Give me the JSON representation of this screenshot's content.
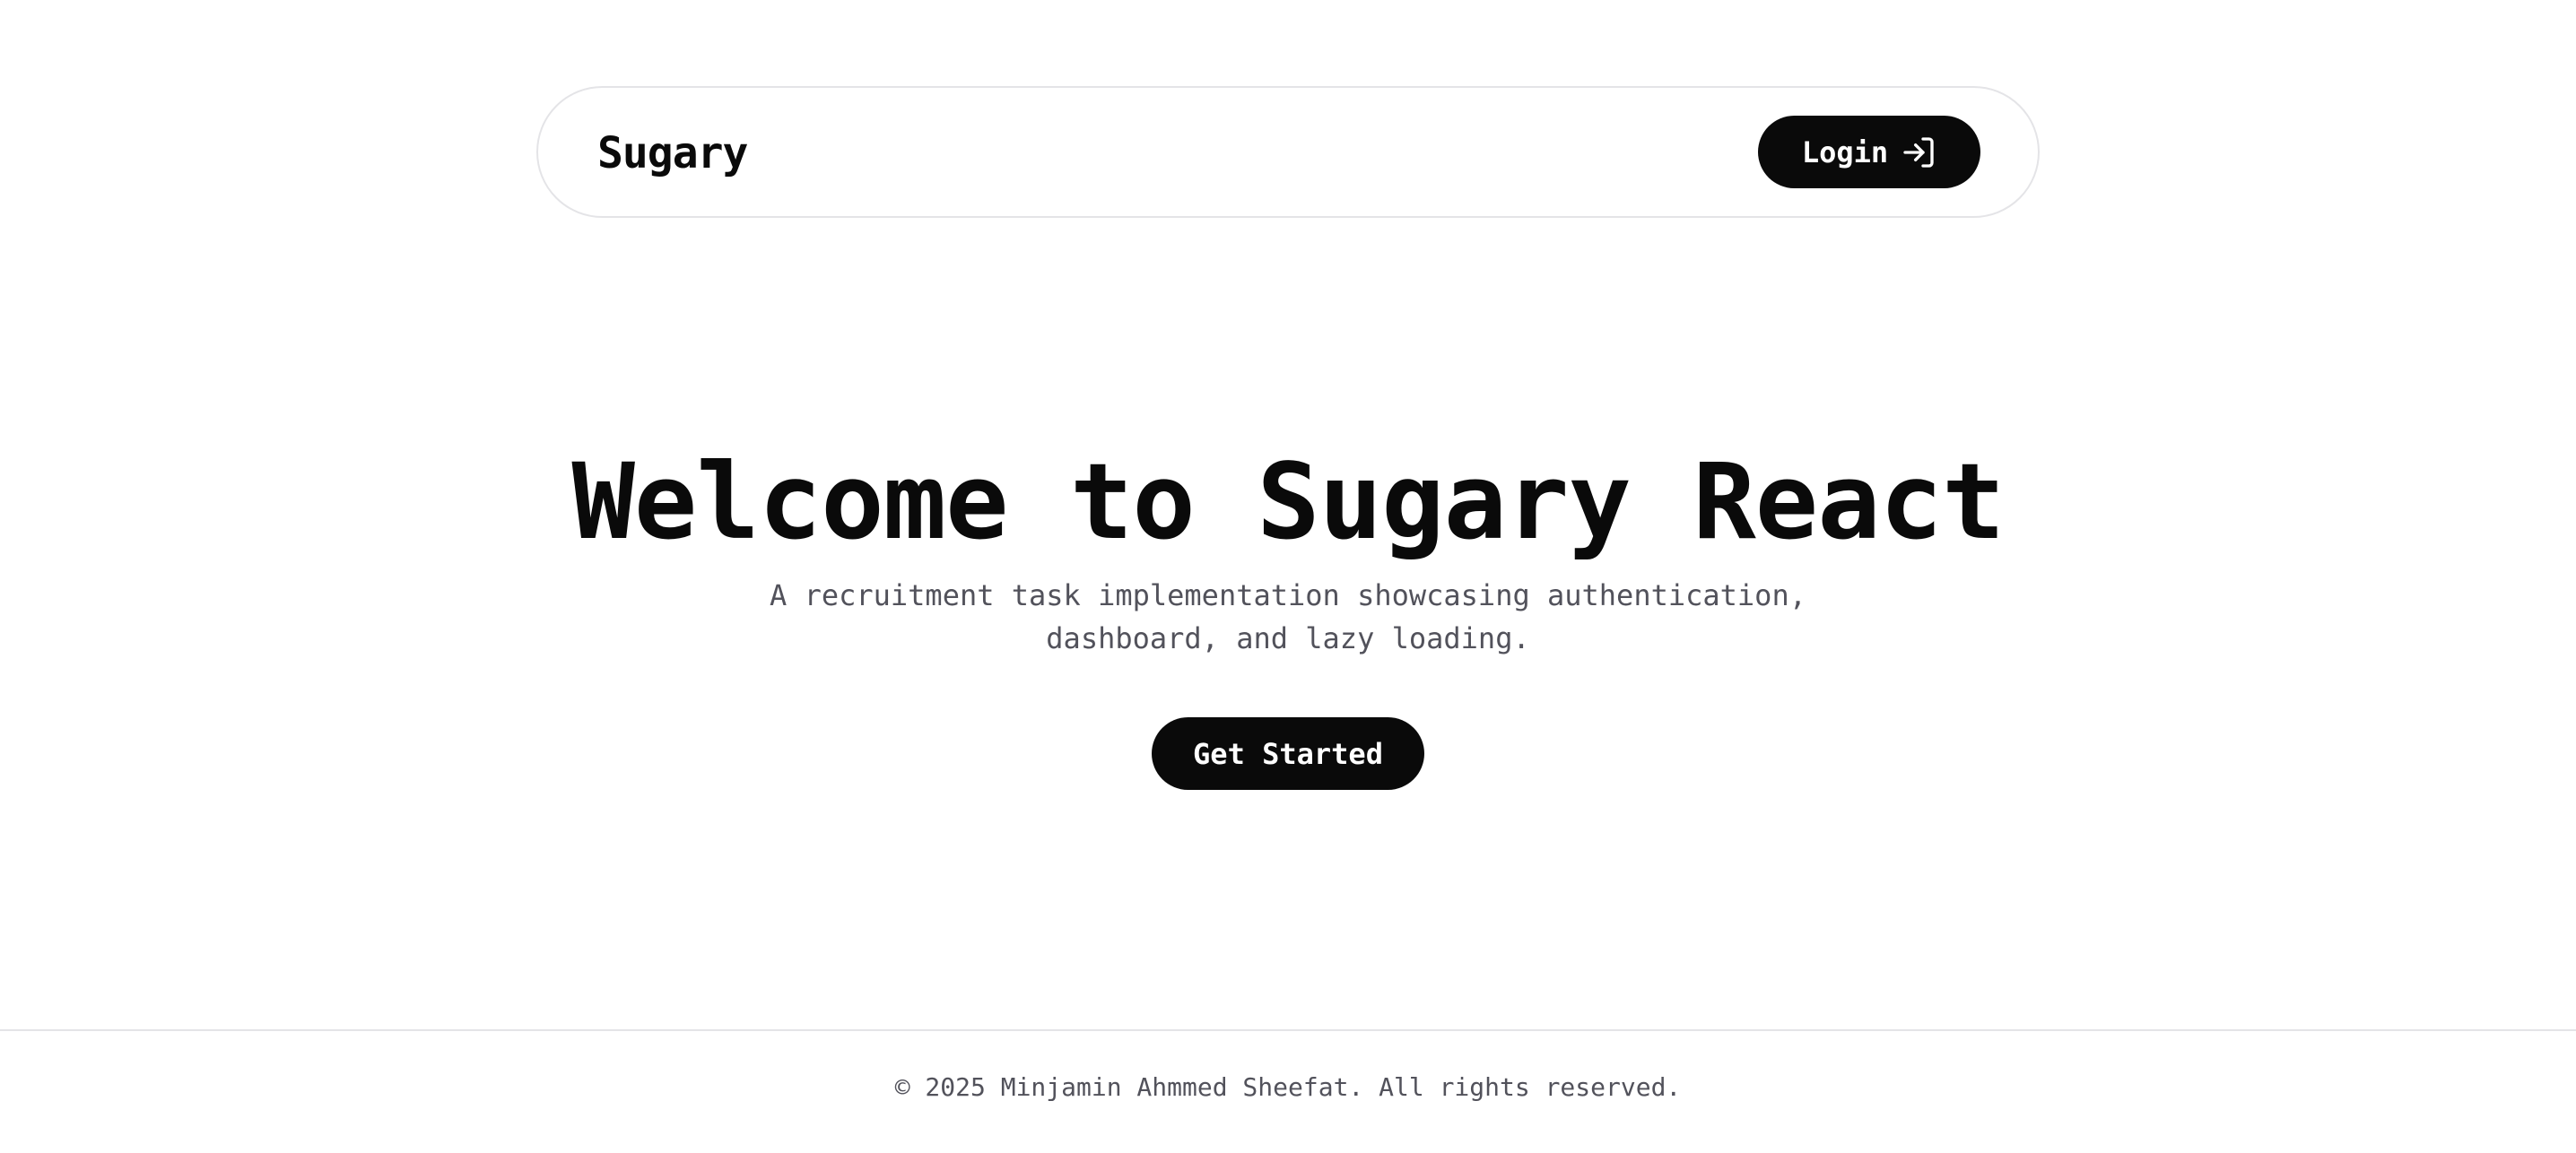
{
  "header": {
    "brand": "Sugary",
    "login_label": "Login",
    "login_icon": "log-in-icon"
  },
  "hero": {
    "title": "Welcome to Sugary React",
    "subtitle": "A recruitment task implementation showcasing authentication, dashboard, and lazy loading.",
    "cta_label": "Get Started"
  },
  "footer": {
    "copyright": "© 2025 Minjamin Ahmmed Sheefat. All rights reserved."
  },
  "colors": {
    "background": "#ffffff",
    "primary": "#0a0a0a",
    "muted_text": "#52525b",
    "border": "#e4e4e7"
  }
}
